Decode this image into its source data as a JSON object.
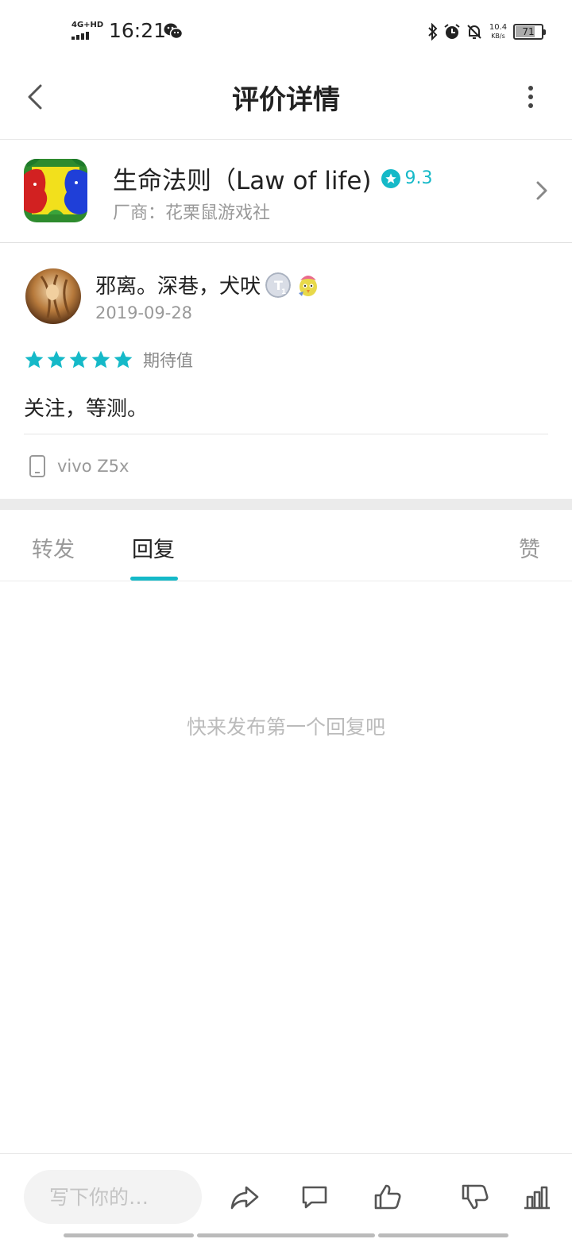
{
  "status_bar": {
    "network": "4G+HD",
    "time": "16:21",
    "speed_value": "10.4",
    "speed_unit": "KB/s",
    "battery": "71"
  },
  "header": {
    "title": "评价详情"
  },
  "app": {
    "name": "生命法则（Law of life)",
    "score": "9.3",
    "vendor": "厂商：花栗鼠游戏社"
  },
  "review": {
    "user_name": "邪离。深巷，犬吠",
    "date": "2019-09-28",
    "stars": 5,
    "rating_label": "期待值",
    "text": "关注，等测。",
    "device": "vivo Z5x"
  },
  "tabs": [
    {
      "label": "转发"
    },
    {
      "label": "回复"
    },
    {
      "label": "赞"
    }
  ],
  "empty_message": "快来发布第一个回复吧",
  "bottom_bar": {
    "input_placeholder": "写下你的…"
  },
  "colors": {
    "accent": "#15b9c8"
  },
  "icons": {
    "back": "chevron-left-icon",
    "more": "more-vertical-icon",
    "share": "share-icon",
    "comment": "comment-icon",
    "like": "thumbs-up-icon",
    "dislike": "thumbs-down-icon",
    "stats": "bar-chart-icon",
    "device": "phone-icon"
  }
}
